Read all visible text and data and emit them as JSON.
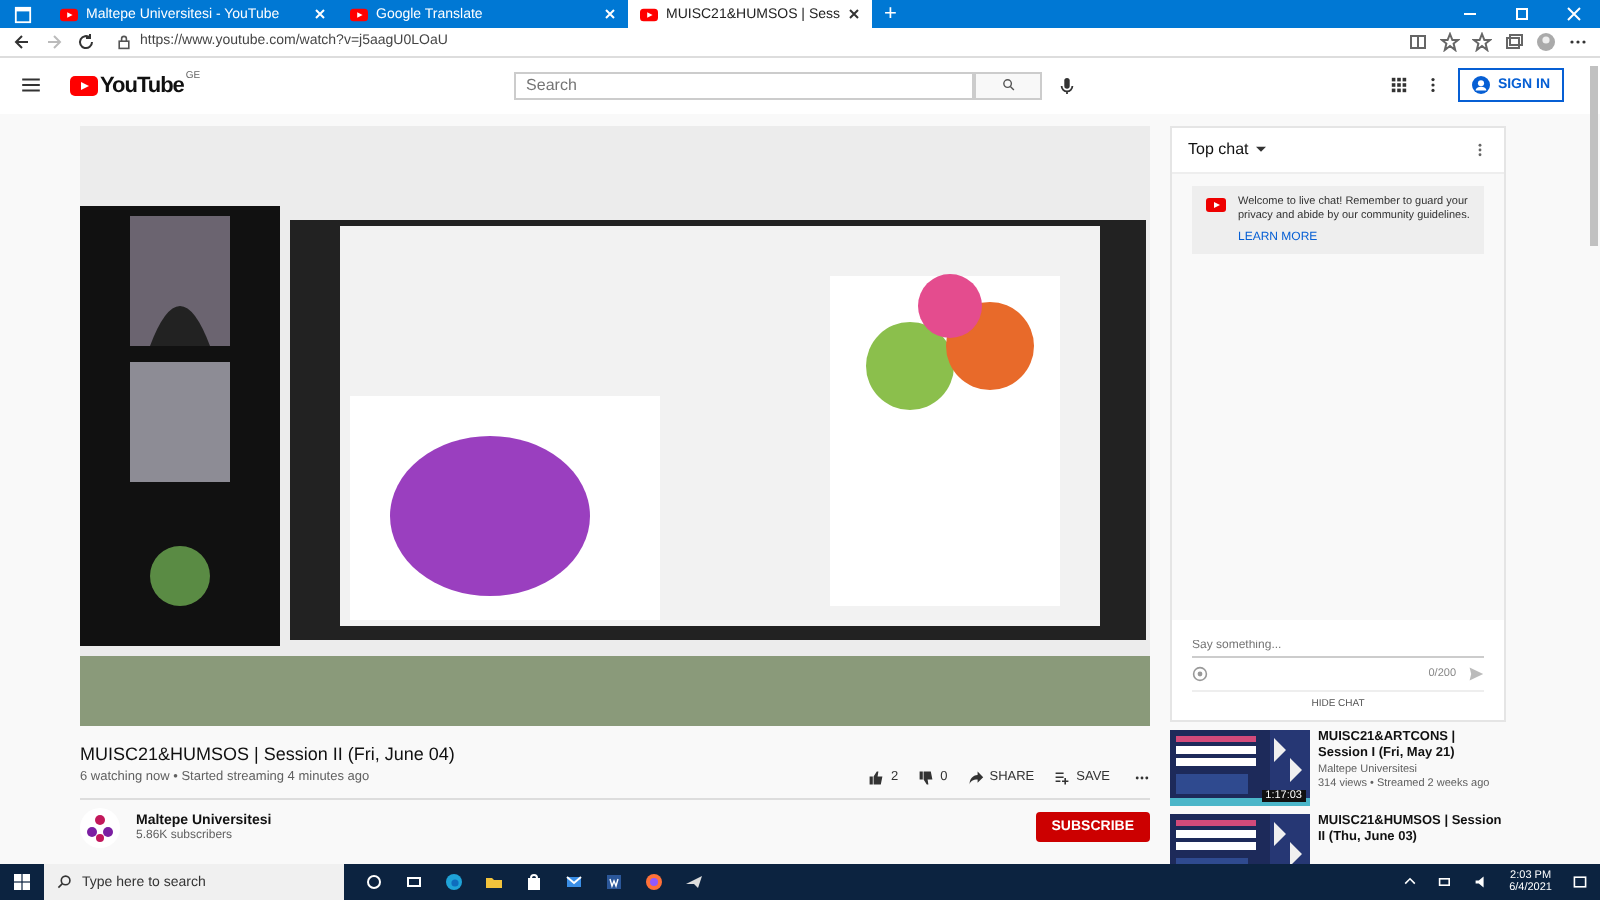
{
  "browser": {
    "tabs": [
      {
        "title": "Maltepe Universitesi - YouTube",
        "selected": false
      },
      {
        "title": "Google Translate",
        "selected": false
      },
      {
        "title": "MUISC21&HUMSOS | Sess",
        "selected": true
      }
    ],
    "new_tab": "+",
    "url": "https://www.youtube.com/watch?v=j5aagU0LOaU"
  },
  "header": {
    "logo": "YouTube",
    "country": "GE",
    "search": {
      "placeholder": "Search"
    },
    "sign_in": "SIGN IN"
  },
  "chat": {
    "title": "Top chat",
    "welcome": "Welcome to live chat! Remember to guard your privacy and abide by our community guidelines.",
    "learn_more": "LEARN MORE",
    "input": {
      "placeholder": "Say something..."
    },
    "counter": "0/200",
    "hide": "HIDE CHAT"
  },
  "video_info": {
    "title": "MUISC21&HUMSOS | Session II (Fri, June 04)",
    "meta": "6 watching now • Started streaming 4 minutes ago",
    "likes": "2",
    "dislikes": "0",
    "share": "SHARE",
    "save": "SAVE"
  },
  "channel": {
    "name": "Maltepe Universitesi",
    "subscribers": "5.86K subscribers",
    "subscribe": "SUBSCRIBE"
  },
  "related": [
    {
      "title": "MUISC21&ARTCONS | Session I (Fri, May 21)",
      "channel": "Maltepe Universitesi",
      "meta": "314 views • Streamed 2 weeks ago",
      "duration": "1:17:03"
    },
    {
      "title": "MUISC21&HUMSOS | Session II (Thu, June 03)"
    }
  ],
  "taskbar": {
    "search": {
      "placeholder": "Type here to search"
    },
    "time": "2:03 PM",
    "date": "6/4/2021"
  }
}
